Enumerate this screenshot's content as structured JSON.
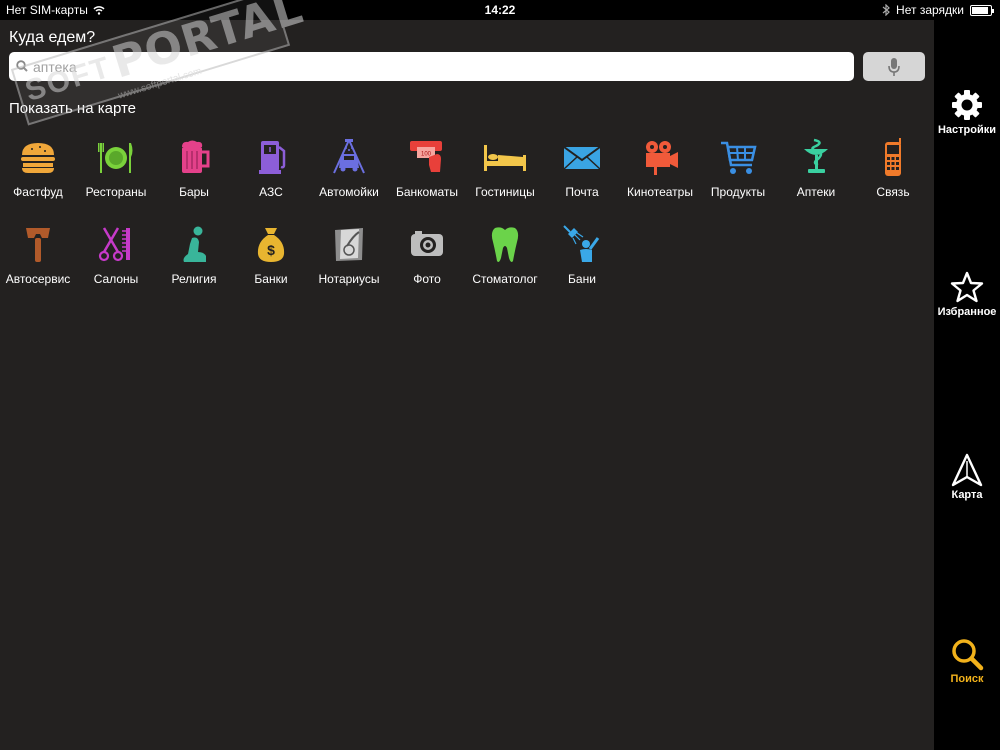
{
  "status_bar": {
    "carrier": "Нет SIM-карты",
    "time": "14:22",
    "charging": "Нет зарядки"
  },
  "main": {
    "prompt": "Куда едем?",
    "search": {
      "value": "",
      "placeholder": "аптека"
    },
    "show_on_map": "Показать на карте"
  },
  "categories": [
    {
      "label": "Фастфуд",
      "icon": "burger-icon",
      "color": "#f0a73a"
    },
    {
      "label": "Рестораны",
      "icon": "plate-cutlery-icon",
      "color": "#7ad23b"
    },
    {
      "label": "Бары",
      "icon": "beer-mug-icon",
      "color": "#e4418a"
    },
    {
      "label": "АЗС",
      "icon": "fuel-pump-icon",
      "color": "#8c5ed8"
    },
    {
      "label": "Автомойки",
      "icon": "car-wash-icon",
      "color": "#6b6fe0"
    },
    {
      "label": "Банкоматы",
      "icon": "atm-icon",
      "color": "#e8403a"
    },
    {
      "label": "Гостиницы",
      "icon": "bed-icon",
      "color": "#f2c64a"
    },
    {
      "label": "Почта",
      "icon": "envelope-icon",
      "color": "#3aa4e3"
    },
    {
      "label": "Кинотеатры",
      "icon": "movie-camera-icon",
      "color": "#f05a3a"
    },
    {
      "label": "Продукты",
      "icon": "shopping-cart-icon",
      "color": "#3a8fe3"
    },
    {
      "label": "Аптеки",
      "icon": "pharmacy-icon",
      "color": "#3ad0a0"
    },
    {
      "label": "Связь",
      "icon": "phone-icon",
      "color": "#f07a2a"
    },
    {
      "label": "Автосервис",
      "icon": "wrench-icon",
      "color": "#b15a2a"
    },
    {
      "label": "Салоны",
      "icon": "scissors-comb-icon",
      "color": "#c63ac9"
    },
    {
      "label": "Религия",
      "icon": "praying-icon",
      "color": "#39b59a"
    },
    {
      "label": "Банки",
      "icon": "money-bag-icon",
      "color": "#e8b530"
    },
    {
      "label": "Нотариусы",
      "icon": "document-seal-icon",
      "color": "#8e8e8e"
    },
    {
      "label": "Фото",
      "icon": "camera-icon",
      "color": "#bdbdbd"
    },
    {
      "label": "Стоматолог",
      "icon": "tooth-icon",
      "color": "#6bd34a"
    },
    {
      "label": "Бани",
      "icon": "shower-icon",
      "color": "#3aa8e8"
    }
  ],
  "sidebar": {
    "items": [
      {
        "label": "Настройки",
        "icon": "gear-icon"
      },
      {
        "label": "Избранное",
        "icon": "star-icon"
      },
      {
        "label": "Карта",
        "icon": "navigation-arrow-icon"
      },
      {
        "label": "Поиск",
        "icon": "search-icon",
        "active": true
      }
    ]
  },
  "watermark": {
    "brand_a": "SOFT",
    "brand_b": "PORTAL",
    "url": "www.softportal.com",
    "tm": "TM"
  },
  "colors": {
    "background": "#232120",
    "sidebar": "#000000",
    "accent": "#f2b21b"
  }
}
